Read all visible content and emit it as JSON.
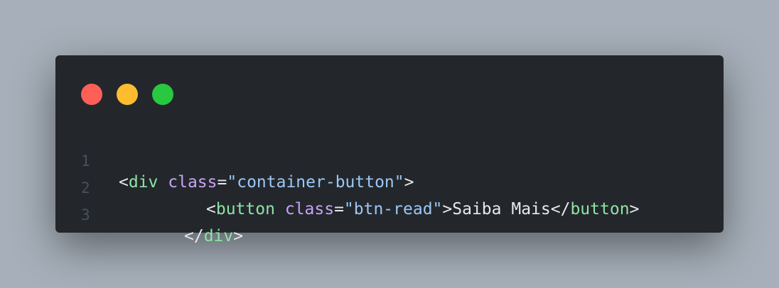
{
  "window": {
    "controls": [
      "close",
      "minimize",
      "maximize"
    ]
  },
  "colors": {
    "background": "#a7b0ba",
    "editor": "#23272c",
    "close": "#ff5f57",
    "minimize": "#febc2e",
    "maximize": "#28c840",
    "tag": "#8ee3a2",
    "attr": "#c9a2f5",
    "string": "#9cc7f4"
  },
  "code": {
    "lines": [
      {
        "number": "1",
        "open": "<",
        "tag": "div",
        "sp": " ",
        "attr": "class",
        "eq": "=",
        "value": "\"container-button\"",
        "close": ">"
      },
      {
        "number": "2",
        "open": "<",
        "tag": "button",
        "sp": " ",
        "attr": "class",
        "eq": "=",
        "value": "\"btn-read\"",
        "close": ">",
        "text": "Saiba Mais",
        "end_open": "</",
        "end_tag": "button",
        "end_close": ">"
      },
      {
        "number": "3",
        "end_open": "</",
        "end_tag": "div",
        "end_close": ">"
      }
    ]
  }
}
